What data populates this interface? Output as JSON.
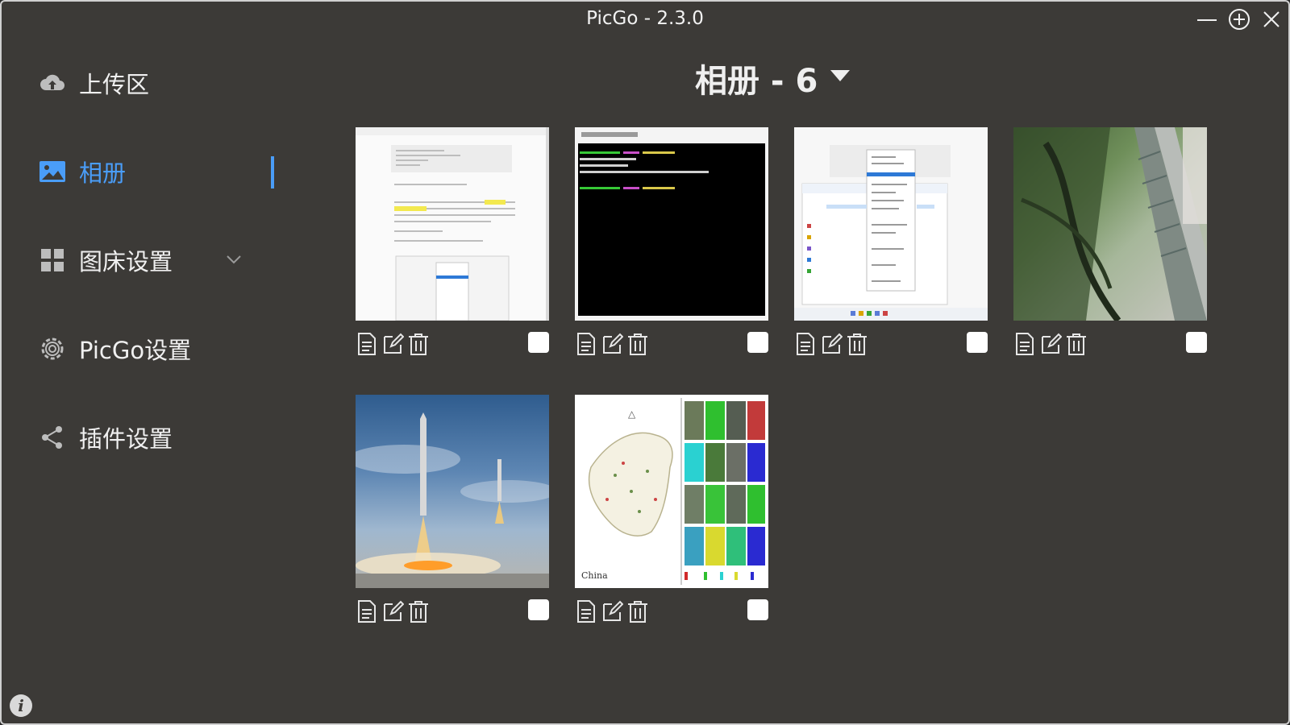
{
  "window": {
    "title": "PicGo - 2.3.0"
  },
  "sidebar": {
    "items": [
      {
        "label": "上传区",
        "icon": "cloud-upload-icon"
      },
      {
        "label": "相册",
        "icon": "image-icon",
        "active": true
      },
      {
        "label": "图床设置",
        "icon": "grid-icon",
        "expandable": true
      },
      {
        "label": "PicGo设置",
        "icon": "gear-icon"
      },
      {
        "label": "插件设置",
        "icon": "share-icon"
      }
    ]
  },
  "album": {
    "title": "相册 - 6"
  },
  "gallery": {
    "items": [
      {
        "name": "document-screenshot",
        "kind": "doc"
      },
      {
        "name": "terminal-screenshot",
        "kind": "terminal"
      },
      {
        "name": "explorer-screenshot",
        "kind": "explorer"
      },
      {
        "name": "forest-bridge-photo",
        "kind": "forest"
      },
      {
        "name": "rocket-landing-photo",
        "kind": "rocket"
      },
      {
        "name": "china-map-figure",
        "kind": "map",
        "caption": "China"
      }
    ]
  },
  "colors": {
    "accent": "#4a9df8",
    "background": "#3c3a37",
    "text": "#f0f0f0"
  }
}
